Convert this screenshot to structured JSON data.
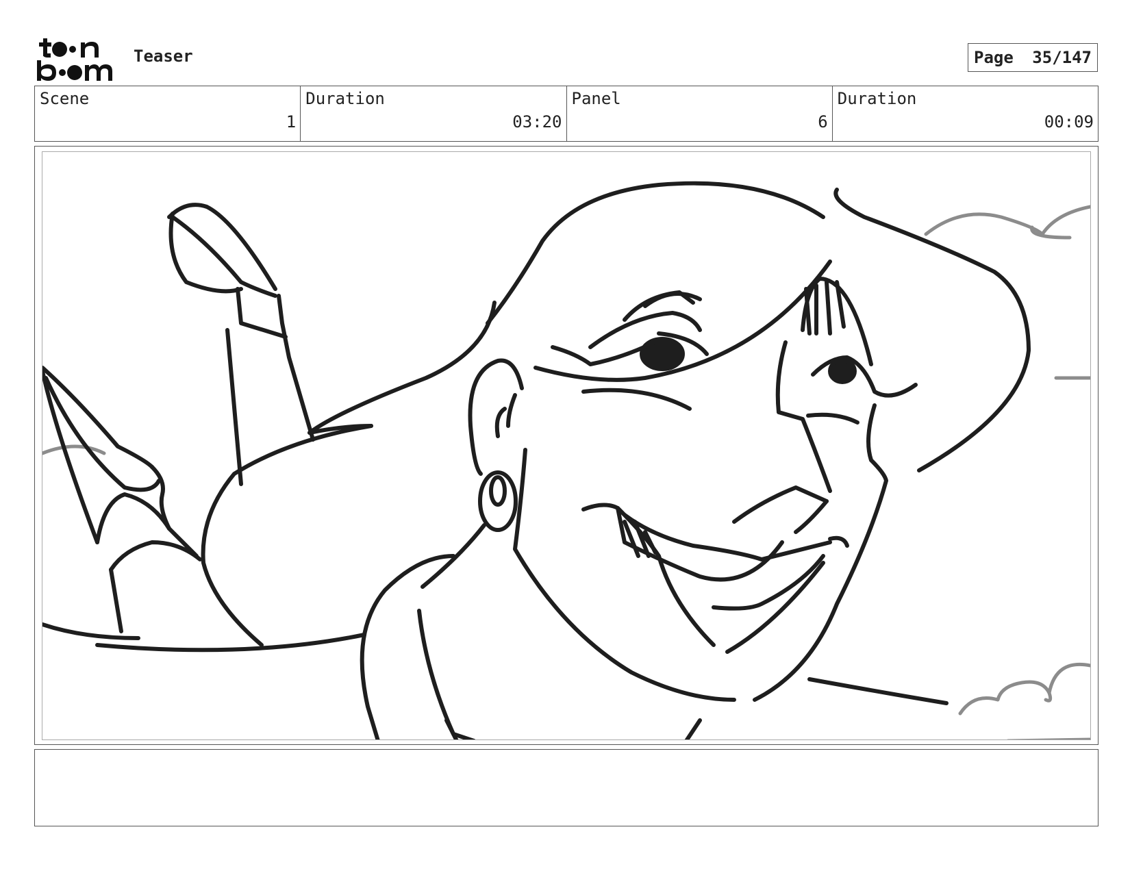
{
  "header": {
    "logo_alt": "toon boom",
    "project_title": "Teaser",
    "page_label": "Page",
    "page_number": "35/147"
  },
  "info": {
    "scene_label": "Scene",
    "scene_value": "1",
    "scene_duration_label": "Duration",
    "scene_duration_value": "03:20",
    "panel_label": "Panel",
    "panel_value": "6",
    "panel_duration_label": "Duration",
    "panel_duration_value": "00:09"
  },
  "notes": {
    "text": ""
  },
  "colors": {
    "ink": "#1e1e1e",
    "cloud": "#8c8c8c",
    "border": "#555555"
  }
}
